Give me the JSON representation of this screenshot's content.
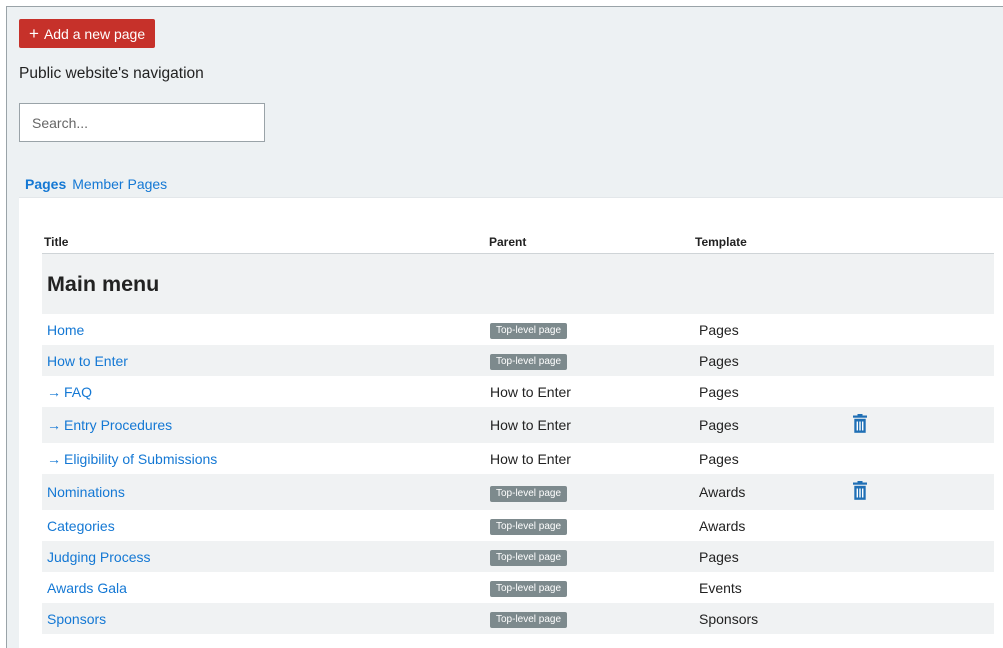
{
  "toolbar": {
    "add_button_label": "Add a new page",
    "add_icon": "plus-icon"
  },
  "nav_heading": "Public website's navigation",
  "search": {
    "placeholder": "Search...",
    "value": ""
  },
  "tabs": [
    {
      "label": "Pages",
      "active": true
    },
    {
      "label": "Member Pages",
      "active": false
    }
  ],
  "table": {
    "columns": [
      "Title",
      "Parent",
      "Template"
    ],
    "group_title": "Main menu",
    "rows": [
      {
        "title": "Home",
        "child": false,
        "parent": "Top-level page",
        "parent_is_badge": true,
        "template": "Pages",
        "deletable": false
      },
      {
        "title": "How to Enter",
        "child": false,
        "parent": "Top-level page",
        "parent_is_badge": true,
        "template": "Pages",
        "deletable": false
      },
      {
        "title": "FAQ",
        "child": true,
        "parent": "How to Enter",
        "parent_is_badge": false,
        "template": "Pages",
        "deletable": false
      },
      {
        "title": "Entry Procedures",
        "child": true,
        "parent": "How to Enter",
        "parent_is_badge": false,
        "template": "Pages",
        "deletable": true
      },
      {
        "title": "Eligibility of Submissions",
        "child": true,
        "parent": "How to Enter",
        "parent_is_badge": false,
        "template": "Pages",
        "deletable": false
      },
      {
        "title": "Nominations",
        "child": false,
        "parent": "Top-level page",
        "parent_is_badge": true,
        "template": "Awards",
        "deletable": true
      },
      {
        "title": "Categories",
        "child": false,
        "parent": "Top-level page",
        "parent_is_badge": true,
        "template": "Awards",
        "deletable": false
      },
      {
        "title": "Judging Process",
        "child": false,
        "parent": "Top-level page",
        "parent_is_badge": true,
        "template": "Pages",
        "deletable": false
      },
      {
        "title": "Awards Gala",
        "child": false,
        "parent": "Top-level page",
        "parent_is_badge": true,
        "template": "Events",
        "deletable": false
      },
      {
        "title": "Sponsors",
        "child": false,
        "parent": "Top-level page",
        "parent_is_badge": true,
        "template": "Sponsors",
        "deletable": false
      }
    ]
  },
  "icons": {
    "child_arrow": "arrow-right-icon",
    "delete": "trash-icon"
  },
  "colors": {
    "accent": "#1478d4",
    "primary_button": "#c6312a",
    "badge": "#7d8a8d",
    "delete_icon": "#1f6fb5"
  }
}
